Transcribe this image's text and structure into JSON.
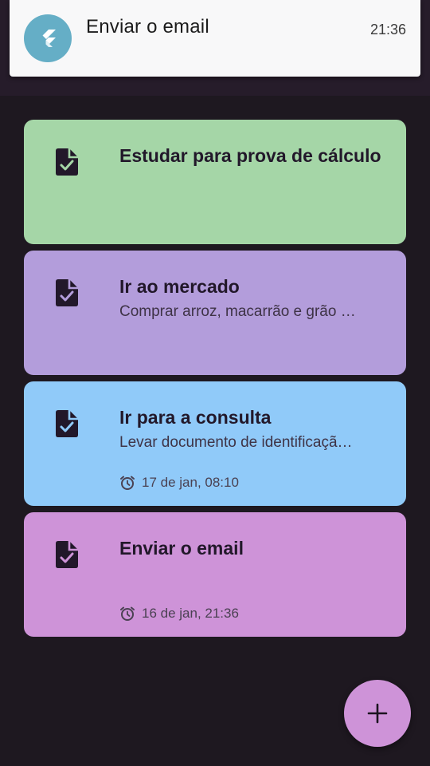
{
  "notification": {
    "app_icon": "flutter-logo-icon",
    "title": "Enviar o email",
    "time": "21:36"
  },
  "tasks": [
    {
      "icon": "task-document-check-icon",
      "title": "Estudar para prova de cálculo",
      "description": "",
      "reminder": "",
      "color": "#a5d6a7"
    },
    {
      "icon": "task-document-check-icon",
      "title": "Ir ao mercado",
      "description": "Comprar arroz, macarrão e grão …",
      "reminder": "",
      "color": "#b39ddb"
    },
    {
      "icon": "task-document-check-icon",
      "title": "Ir para a consulta",
      "description": "Levar documento de identificaçã…",
      "reminder": "17 de jan, 08:10",
      "color": "#90caf9"
    },
    {
      "icon": "task-document-check-icon",
      "title": "Enviar o email",
      "description": "",
      "reminder": "16 de jan, 21:36",
      "color": "#ce93d8"
    }
  ],
  "fab": {
    "icon": "plus-icon",
    "color": "#ce93d8"
  },
  "colors": {
    "background": "#1e1820",
    "appbar": "#261c2a",
    "notification_bg": "#f8f8f9",
    "notification_icon_bg": "#65aec6"
  }
}
